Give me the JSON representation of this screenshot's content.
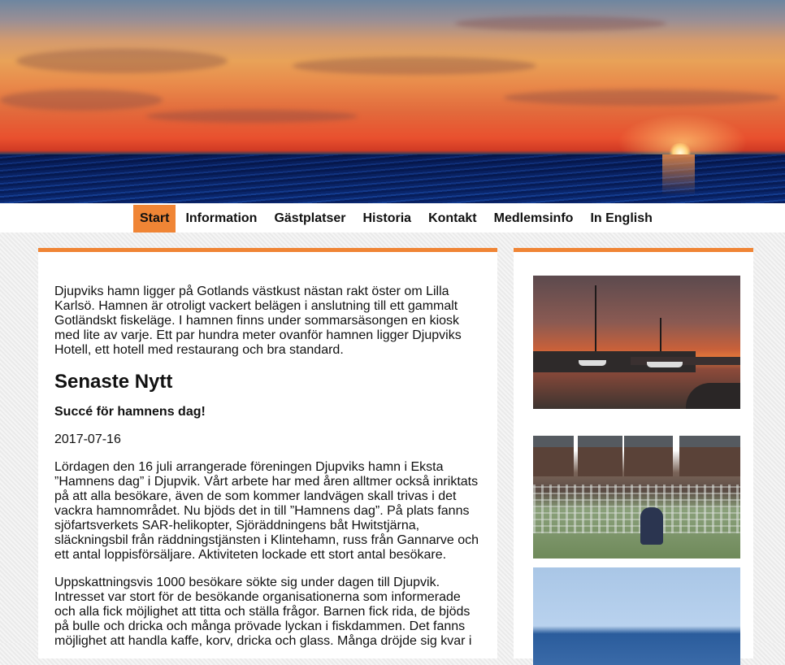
{
  "nav": {
    "items": [
      {
        "label": "Start",
        "active": true
      },
      {
        "label": "Information"
      },
      {
        "label": "Gästplatser"
      },
      {
        "label": "Historia"
      },
      {
        "label": "Kontakt"
      },
      {
        "label": "Medlemsinfo"
      },
      {
        "label": "In English"
      }
    ]
  },
  "main": {
    "intro": "Djupviks hamn ligger på Gotlands västkust nästan rakt öster om Lilla Karlsö. Hamnen är otroligt vackert belägen i anslutning till ett gammalt Gotländskt fiskeläge. I hamnen finns under sommarsäsongen en kiosk med lite av varje. Ett par hundra meter ovanför hamnen ligger Djupviks Hotell, ett hotell med restaurang och bra standard.",
    "news_heading": "Senaste Nytt",
    "news_title": "Succé för hamnens dag!",
    "news_date": "2017-07-16",
    "paragraph1": "Lördagen den 16 juli arrangerade föreningen Djupviks hamn i Eksta ”Hamnens dag” i Djupvik. Vårt arbete har med åren alltmer också inriktats på att alla besökare, även de som kommer landvägen skall trivas i det vackra hamnområdet. Nu bjöds det in till ”Hamnens dag”. På plats fanns sjöfartsverkets SAR-helikopter, Sjöräddningens båt Hwitstjärna, släckningsbil från räddningstjänsten i Klintehamn, russ från Gannarve och ett antal loppisförsäljare. Aktiviteten lockade ett stort antal besökare.",
    "paragraph2": "Uppskattningsvis 1000 besökare sökte sig under dagen till Djupvik. Intresset var stort för de besökande organisationerna som informerade och alla fick möjlighet att titta och ställa frågor. Barnen fick rida, de bjöds på bulle och dricka och många prövade lyckan i fiskdammen. Det fanns möjlighet att handla kaffe, korv, dricka och glass. Många dröjde sig kvar i"
  },
  "colors": {
    "accent": "#f08535",
    "panel": "#ffffff",
    "background": "#efefef"
  }
}
